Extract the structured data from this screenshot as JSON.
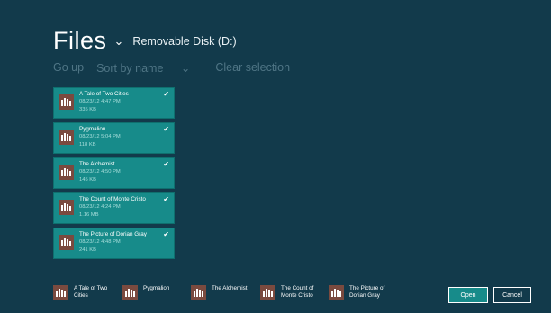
{
  "header": {
    "title": "Files",
    "location": "Removable Disk (D:)"
  },
  "commands": {
    "go_up": "Go up",
    "sort": "Sort by name",
    "clear": "Clear selection"
  },
  "files": [
    {
      "name": "A Tale of Two Cities",
      "date": "08/23/12 4:47 PM",
      "size": "335 KB"
    },
    {
      "name": "Pygmalion",
      "date": "08/23/12 5:04 PM",
      "size": "118 KB"
    },
    {
      "name": "The Alchemist",
      "date": "08/23/12 4:50 PM",
      "size": "145 KB"
    },
    {
      "name": "The Count of Monte Cristo",
      "date": "08/23/12 4:24 PM",
      "size": "1.16 MB"
    },
    {
      "name": "The Picture of Dorian Gray",
      "date": "08/23/12 4:48 PM",
      "size": "241 KB"
    }
  ],
  "basket": [
    {
      "label": "A Tale of Two Cities"
    },
    {
      "label": "Pygmalion"
    },
    {
      "label": "The Alchemist"
    },
    {
      "label": "The Count of Monte Cristo"
    },
    {
      "label": "The Picture of Dorian Gray"
    }
  ],
  "buttons": {
    "open": "Open",
    "cancel": "Cancel"
  },
  "colors": {
    "background": "#123a4b",
    "tile": "#178b8a",
    "thumbnail": "#7a4a3f",
    "command_text": "#4f7585"
  },
  "icons": {
    "file_thumb": "book-library-icon",
    "check": "checkmark-icon",
    "chevron": "chevron-down-icon"
  }
}
